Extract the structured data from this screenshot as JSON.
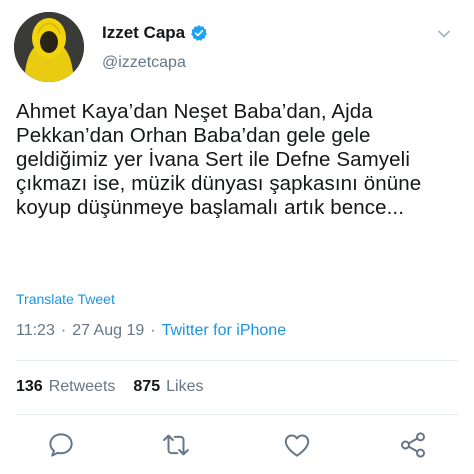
{
  "user": {
    "display_name": "Izzet Capa",
    "handle": "@izzetcapa",
    "verified": true
  },
  "tweet": {
    "text": "Ahmet Kaya’dan Neşet Baba’dan, Ajda Pekkan’dan Orhan Baba’dan gele gele geldiğimiz yer İvana Sert ile Defne Samyeli çıkmazı ise, müzik dünyası şapkasını önüne koyup düşünmeye başlamalı artık bence...",
    "translate_label": "Translate Tweet",
    "time": "11:23",
    "separator": "·",
    "date": "27 Aug 19",
    "source": "Twitter for iPhone"
  },
  "stats": {
    "retweets_count": "136",
    "retweets_label": "Retweets",
    "likes_count": "875",
    "likes_label": "Likes"
  },
  "icons": {
    "reply": "reply-icon",
    "retweet": "retweet-icon",
    "like": "heart-icon",
    "share": "share-icon",
    "menu": "chevron-down-icon",
    "verified": "verified-badge-icon"
  },
  "colors": {
    "accent": "#1b95e0",
    "muted": "#657786",
    "text": "#14171a",
    "avatar_yellow": "#f2d40c"
  }
}
